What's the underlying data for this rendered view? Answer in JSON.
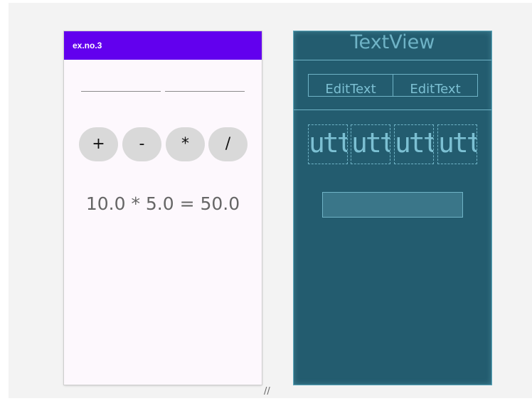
{
  "design_preview": {
    "app_bar": {
      "title": "ex.no.3",
      "color": "#6200ee"
    },
    "operator_buttons": [
      "+",
      "-",
      "*",
      "/"
    ],
    "result_text": "10.0 * 5.0 = 50.0"
  },
  "blueprint_preview": {
    "textview_label": "TextView",
    "edittext_labels": [
      "EditText",
      "EditText"
    ],
    "button_labels": [
      "utto",
      "utto",
      "utto",
      "utto"
    ],
    "color": "#235c6f"
  },
  "resize_handle": {
    "icon": "resize-grip-icon",
    "glyph": "//"
  }
}
